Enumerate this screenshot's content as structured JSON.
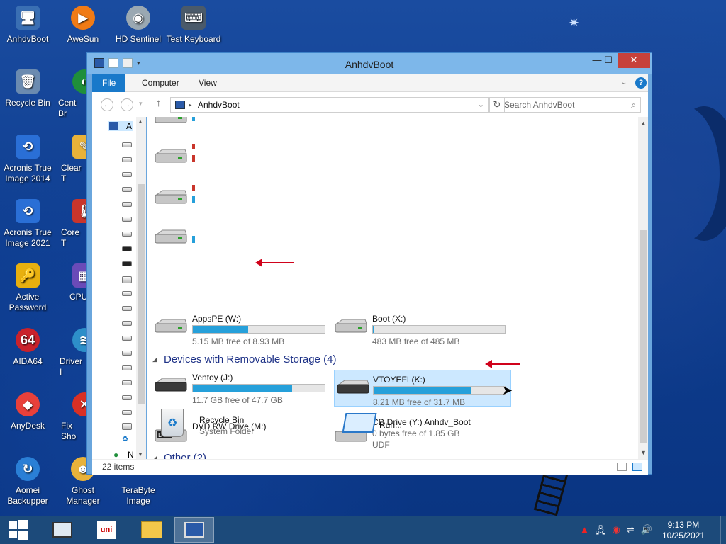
{
  "desktop": {
    "icons": [
      {
        "label": "AnhdvBoot",
        "color": "#3a6fb3",
        "glyph": "🖥"
      },
      {
        "label": "AweSun",
        "color": "#f07b16",
        "glyph": "▶"
      },
      {
        "label": "HD Sentinel",
        "color": "#9aa8b2",
        "glyph": "◉"
      },
      {
        "label": "Test Keyboard",
        "color": "#4a5a6a",
        "glyph": "⌨"
      },
      {
        "label": "Recycle Bin",
        "color": "#6b8bb0",
        "glyph": "🗑"
      },
      {
        "label": "Cent Br",
        "color": "#1f8f3a",
        "glyph": "◐"
      },
      {
        "label": "Acronis True Image 2014",
        "color": "#2a6fd6",
        "glyph": "⟲"
      },
      {
        "label": "Clear T",
        "color": "#e8b23a",
        "glyph": "✎"
      },
      {
        "label": "Acronis True Image 2021",
        "color": "#2a6fd6",
        "glyph": "⟲"
      },
      {
        "label": "Core T",
        "color": "#c9352b",
        "glyph": "🌡"
      },
      {
        "label": "Active Password",
        "color": "#e8b00f",
        "glyph": "🔑"
      },
      {
        "label": "CPU",
        "color": "#6a4bb8",
        "glyph": "▦"
      },
      {
        "label": "AIDA64",
        "color": "#c9222b",
        "glyph": "64"
      },
      {
        "label": "Driver I",
        "color": "#2d8fc9",
        "glyph": "≋"
      },
      {
        "label": "AnyDesk",
        "color": "#e8403a",
        "glyph": "◆"
      },
      {
        "label": "Fix Sho",
        "color": "#d93025",
        "glyph": "✕"
      },
      {
        "label": "Aomei Backupper",
        "color": "#2a7fd6",
        "glyph": "↻"
      },
      {
        "label": "Ghost Manager",
        "color": "#e8b23a",
        "glyph": "☻"
      },
      {
        "label": "TeraByte Image",
        "color": "#2d3a4a",
        "glyph": ""
      }
    ]
  },
  "window": {
    "title": "AnhdvBoot",
    "controls": {
      "minimize": "—",
      "maximize": "☐",
      "close": "✕"
    },
    "ribbon": {
      "file": "File",
      "computer": "Computer",
      "view": "View"
    },
    "address": {
      "path": "AnhdvBoot",
      "search_placeholder": "Search AnhdvBoot"
    },
    "nav": {
      "root_label": "A",
      "net_label": "N"
    },
    "status": "22 items",
    "groups": {
      "removable": "Devices with Removable Storage (4)",
      "other": "Other (2)"
    },
    "drives": [
      {
        "name": "AppsPE (W:)",
        "free": "5.15 MB free of 8.93 MB",
        "used_fraction": 0.42
      },
      {
        "name": "Boot (X:)",
        "free": "483 MB free of 485 MB",
        "used_fraction": 0.01
      },
      {
        "name": "Ventoy (J:)",
        "free": "11.7 GB free of 47.7 GB",
        "used_fraction": 0.75
      },
      {
        "name": "VTOYEFI (K:)",
        "free": "8.21 MB free of 31.7 MB",
        "used_fraction": 0.74
      },
      {
        "name": "DVD RW Drive (M:)"
      },
      {
        "name": "CD Drive (Y:) Anhdv_Boot",
        "free": "0 bytes free of 1.85 GB",
        "fs": "UDF"
      }
    ],
    "others": [
      {
        "name": "Recycle Bin",
        "sub": "System Folder"
      },
      {
        "name": "Run..."
      }
    ]
  },
  "taskbar": {
    "time": "9:13 PM",
    "date": "10/25/2021",
    "items": [
      "start-button",
      "task-manager",
      "unikey",
      "file-explorer",
      "anhdvboot-window"
    ]
  },
  "colors": {
    "accent": "#1979ca",
    "bar_fill": "#26a0da",
    "arrow": "#d0021b",
    "group_header": "#1e3287"
  }
}
